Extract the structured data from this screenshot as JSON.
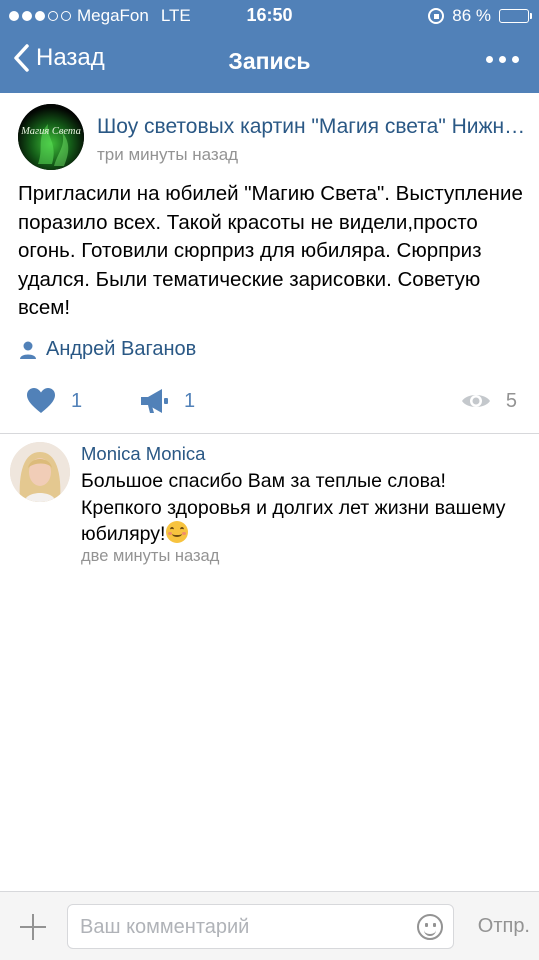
{
  "status_bar": {
    "carrier": "MegaFon",
    "network": "LTE",
    "time": "16:50",
    "battery": "86 %",
    "battery_level": 0.86,
    "signal_bars_filled": 3,
    "signal_bars_total": 5
  },
  "navbar": {
    "back_label": "Назад",
    "title": "Запись",
    "bg_color": "#5181b8"
  },
  "post": {
    "group_name": "Шоу световых картин \"Магия света\" Нижний Новгород",
    "time": "три минуты назад",
    "text": "Пригласили на юбилей \"Магию Света\". Выступление поразило всех. Такой красоты не видели,просто огонь. Готовили сюрприз для юбиляра. Сюрприз удался. Были тематические зарисовки. Советую всем!",
    "author": "Андрей Ваганов",
    "likes": "1",
    "shares": "1",
    "views": "5",
    "avatar_text": "Магия Света"
  },
  "comment": {
    "author": "Monica Monica",
    "text": "Большое спасибо Вам за теплые слова! Крепкого здоровья и долгих лет жизни вашему юбиляру!",
    "time": "две минуты назад"
  },
  "composer": {
    "placeholder": "Ваш комментарий",
    "send_label": "Отпр."
  },
  "colors": {
    "accent": "#5181b8",
    "link": "#2a5885",
    "muted": "#939393"
  }
}
